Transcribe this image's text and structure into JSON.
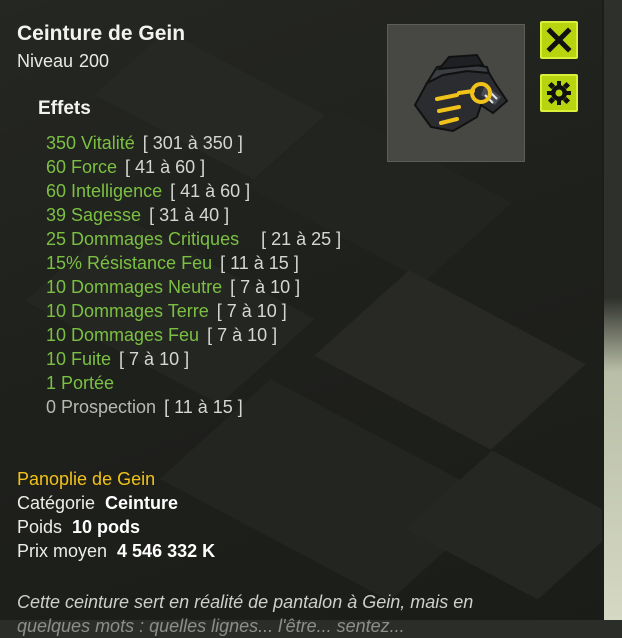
{
  "item": {
    "name": "Ceinture de Gein",
    "level_label": "Niveau",
    "level": "200"
  },
  "effects": {
    "title": "Effets",
    "list": [
      {
        "value": "350 Vitalité",
        "range": "[ 301 à 350 ]"
      },
      {
        "value": "60 Force",
        "range": "[ 41 à 60 ]"
      },
      {
        "value": "60 Intelligence",
        "range": "[ 41 à 60 ]"
      },
      {
        "value": "39 Sagesse",
        "range": "[ 31 à 40 ]"
      },
      {
        "value": "25 Dommages Critiques",
        "range": "[ 21 à 25 ]"
      },
      {
        "value": "15% Résistance Feu",
        "range": "[ 11 à 15 ]"
      },
      {
        "value": "10 Dommages Neutre",
        "range": "[ 7 à 10 ]"
      },
      {
        "value": "10 Dommages Terre",
        "range": "[ 7 à 10 ]"
      },
      {
        "value": "10 Dommages Feu",
        "range": "[ 7 à 10 ]"
      },
      {
        "value": "10 Fuite",
        "range": "[ 7 à 10 ]"
      },
      {
        "value": "1 Portée",
        "range": ""
      },
      {
        "value": "0 Prospection",
        "range": "[ 11 à 15 ]"
      }
    ]
  },
  "set_name": "Panoplie de Gein",
  "category": {
    "label": "Catégorie",
    "value": "Ceinture"
  },
  "weight": {
    "label": "Poids",
    "value": "10 pods"
  },
  "avg_price": {
    "label": "Prix moyen",
    "value": "4 546 332 K"
  },
  "description": "Cette ceinture sert en réalité de pantalon à Gein, mais en",
  "description_cutoff": "quelques mots : quelles lignes... l'être... sentez...",
  "colors": {
    "effect_value": "#7cc043",
    "set_name": "#f0c21a",
    "button": "#b7d40f"
  },
  "icons": {
    "close": "close-icon",
    "settings": "gear-icon",
    "item": "belt-icon"
  }
}
